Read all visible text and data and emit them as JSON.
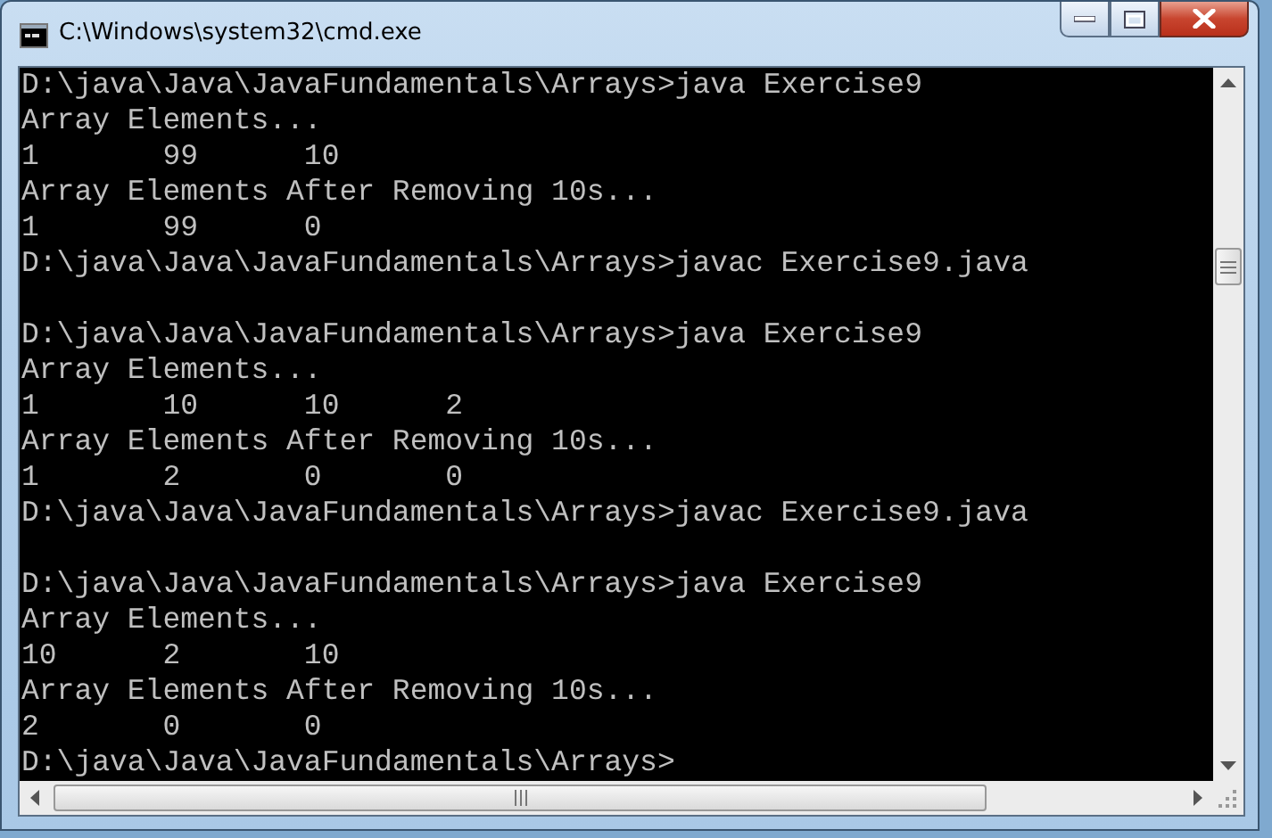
{
  "window": {
    "title": "C:\\Windows\\system32\\cmd.exe"
  },
  "console": {
    "lines": [
      {
        "kind": "text",
        "text": "D:\\java\\Java\\JavaFundamentals\\Arrays>java Exercise9"
      },
      {
        "kind": "text",
        "text": "Array Elements..."
      },
      {
        "kind": "text",
        "text": "1       99      10"
      },
      {
        "kind": "text",
        "text": "Array Elements After Removing 10s..."
      },
      {
        "kind": "text",
        "text": "1       99      0"
      },
      {
        "kind": "text",
        "text": "D:\\java\\Java\\JavaFundamentals\\Arrays>javac Exercise9.java"
      },
      {
        "kind": "blank"
      },
      {
        "kind": "text",
        "text": "D:\\java\\Java\\JavaFundamentals\\Arrays>java Exercise9"
      },
      {
        "kind": "text",
        "text": "Array Elements..."
      },
      {
        "kind": "text",
        "text": "1       10      10      2"
      },
      {
        "kind": "text",
        "text": "Array Elements After Removing 10s..."
      },
      {
        "kind": "text",
        "text": "1       2       0       0"
      },
      {
        "kind": "text",
        "text": "D:\\java\\Java\\JavaFundamentals\\Arrays>javac Exercise9.java"
      },
      {
        "kind": "blank"
      },
      {
        "kind": "text",
        "text": "D:\\java\\Java\\JavaFundamentals\\Arrays>java Exercise9"
      },
      {
        "kind": "text",
        "text": "Array Elements..."
      },
      {
        "kind": "text",
        "text": "10      2       10"
      },
      {
        "kind": "text",
        "text": "Array Elements After Removing 10s..."
      },
      {
        "kind": "text",
        "text": "2       0       0"
      },
      {
        "kind": "text",
        "text": "D:\\java\\Java\\JavaFundamentals\\Arrays>"
      }
    ]
  }
}
